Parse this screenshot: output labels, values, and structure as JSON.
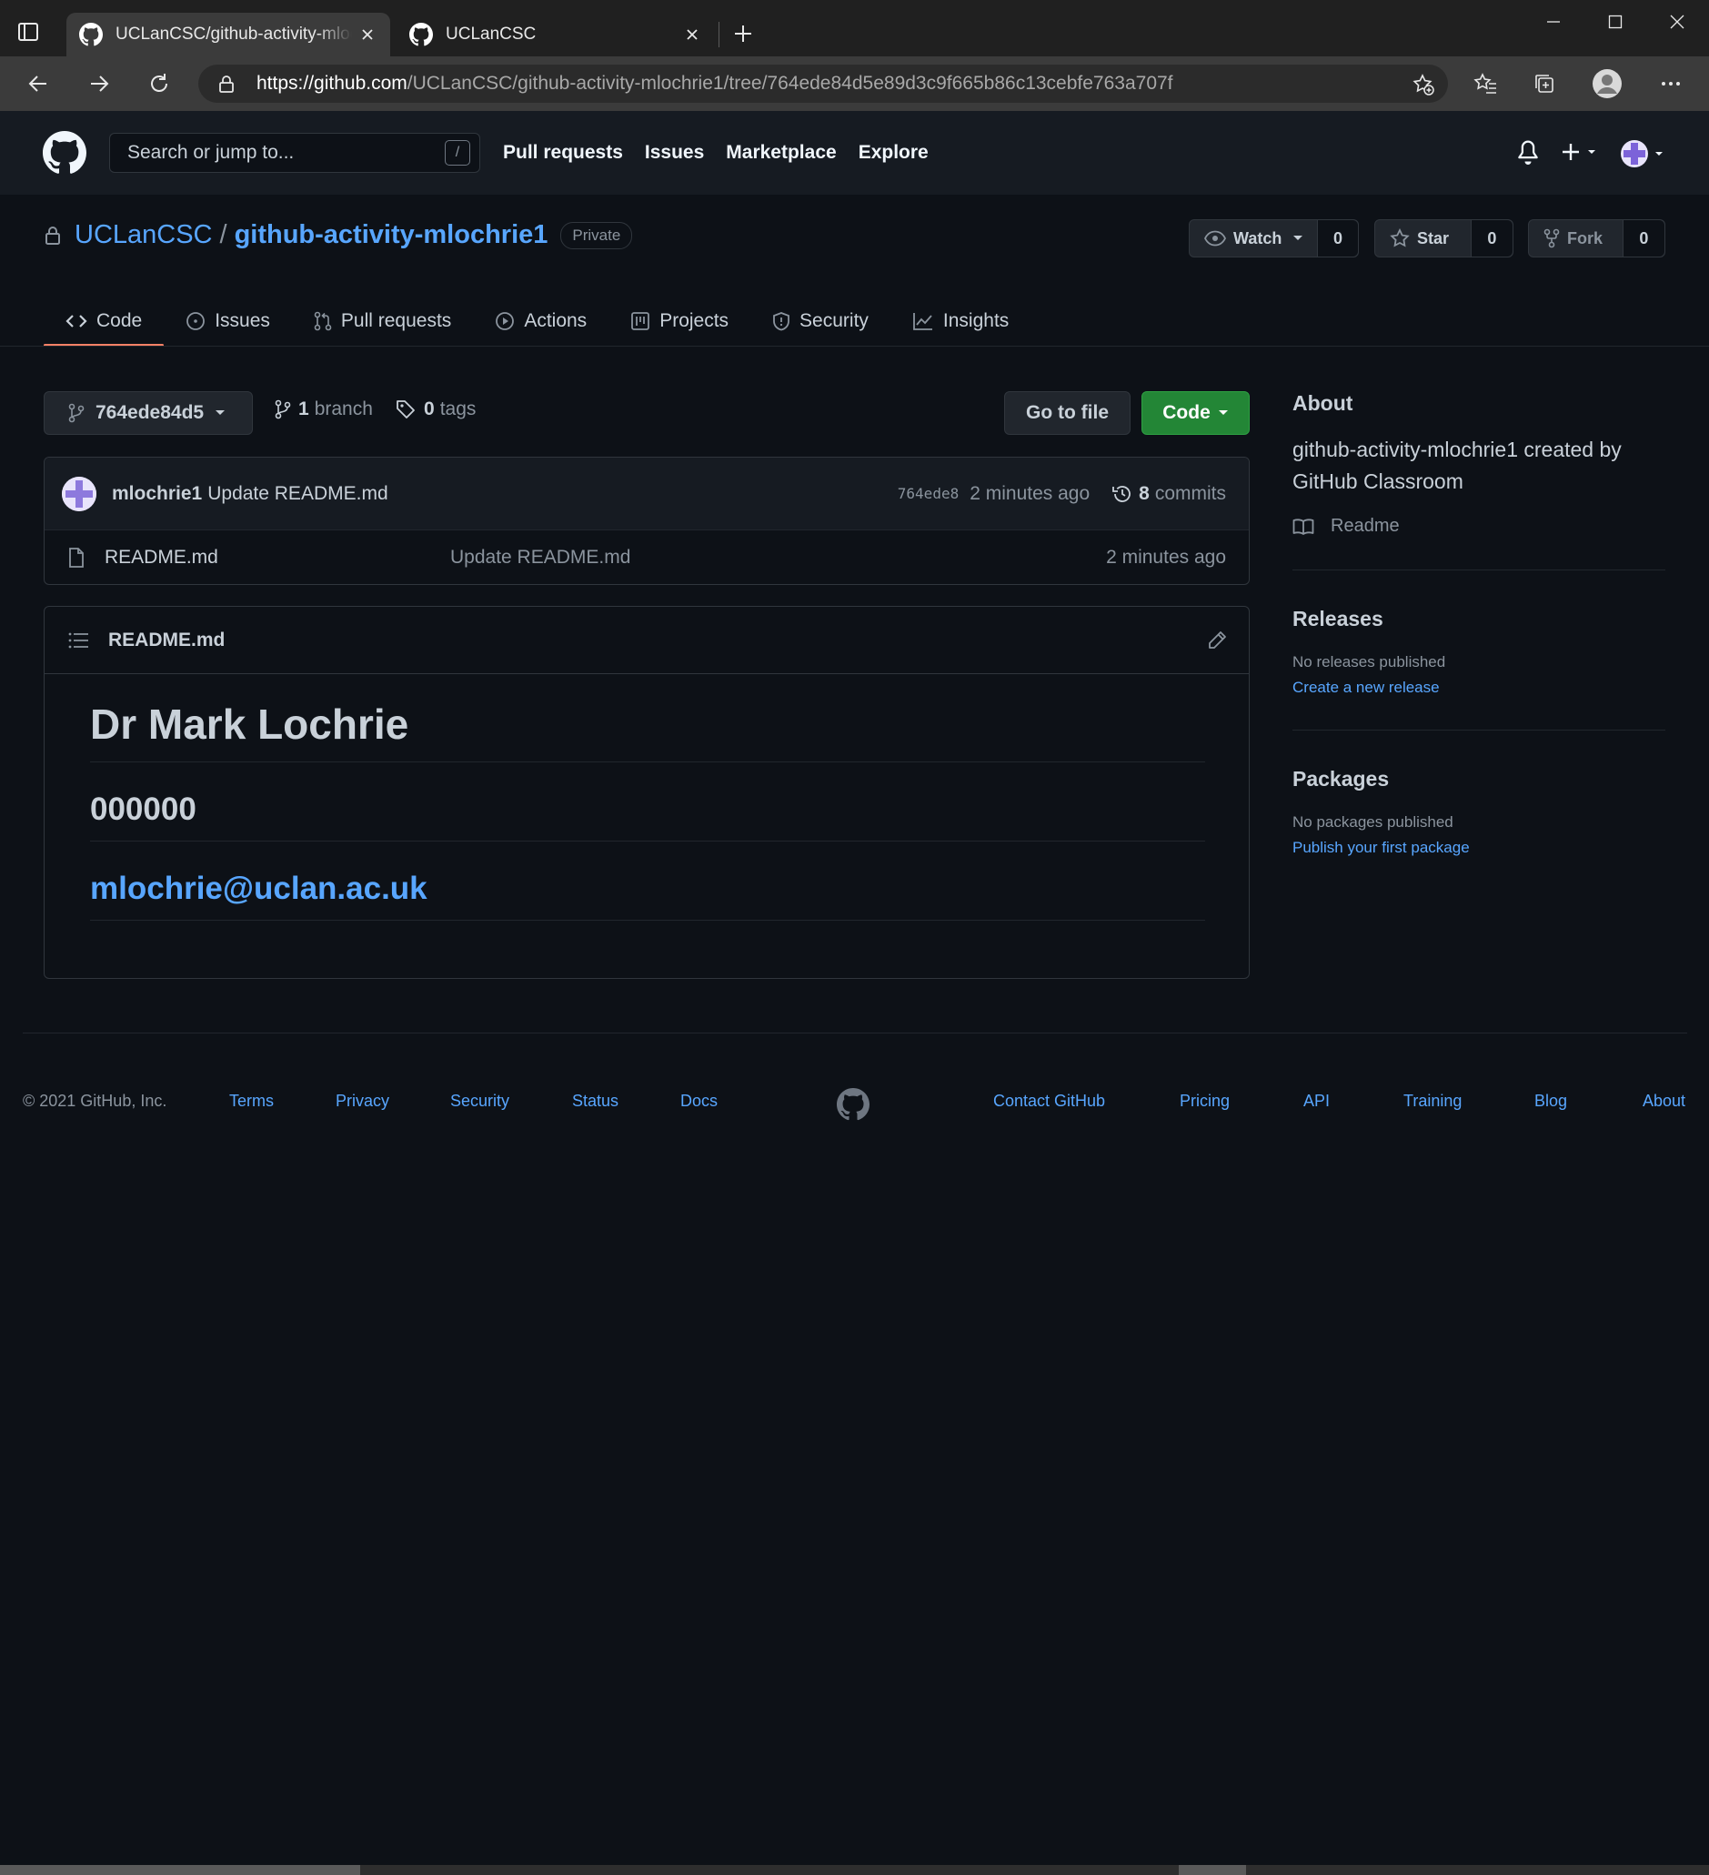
{
  "browser": {
    "tabs": [
      {
        "title": "UCLanCSC/github-activity-mlochrie1",
        "active": true,
        "icon": "github-icon"
      },
      {
        "title": "UCLanCSC",
        "active": false,
        "icon": "github-icon"
      }
    ],
    "url_host": "https://github.com",
    "url_path": "/UCLanCSC/github-activity-mlochrie1/tree/764ede84d5e89d3c9f665b86c13cebfe763a707f"
  },
  "header": {
    "search_placeholder": "Search or jump to...",
    "search_shortcut": "/",
    "nav": [
      "Pull requests",
      "Issues",
      "Marketplace",
      "Explore"
    ]
  },
  "repo": {
    "owner": "UCLanCSC",
    "separator": "/",
    "name": "github-activity-mlochrie1",
    "visibility": "Private",
    "watch_label": "Watch",
    "watch_count": "0",
    "star_label": "Star",
    "star_count": "0",
    "fork_label": "Fork",
    "fork_count": "0"
  },
  "tabs": [
    "Code",
    "Issues",
    "Pull requests",
    "Actions",
    "Projects",
    "Security",
    "Insights"
  ],
  "filebar": {
    "branch": "764ede84d5",
    "branch_count": "1",
    "branch_word": "branch",
    "tag_count": "0",
    "tag_word": "tags",
    "go_to_file": "Go to file",
    "code_button": "Code"
  },
  "commit": {
    "author": "mlochrie1",
    "message": "Update README.md",
    "sha": "764ede8",
    "ago": "2 minutes ago",
    "commit_count": "8",
    "commit_word": "commits"
  },
  "files": [
    {
      "name": "README.md",
      "message": "Update README.md",
      "age": "2 minutes ago"
    }
  ],
  "readme": {
    "filename": "README.md",
    "heading": "Dr Mark Lochrie",
    "id_number": "000000",
    "email": "mlochrie@uclan.ac.uk"
  },
  "sidebar": {
    "about_title": "About",
    "about_desc": "github-activity-mlochrie1 created by GitHub Classroom",
    "readme_link": "Readme",
    "releases_title": "Releases",
    "releases_empty": "No releases published",
    "releases_link": "Create a new release",
    "packages_title": "Packages",
    "packages_empty": "No packages published",
    "packages_link": "Publish your first package"
  },
  "footer": {
    "copyright": "© 2021 GitHub, Inc.",
    "links": [
      "Terms",
      "Privacy",
      "Security",
      "Status",
      "Docs",
      "Contact GitHub",
      "Pricing",
      "API",
      "Training",
      "Blog",
      "About"
    ]
  },
  "colors": {
    "background": "#0d1117",
    "header_bg": "#161b22",
    "link": "#58a6ff",
    "code_button": "#238636",
    "tab_underline": "#f78166"
  }
}
